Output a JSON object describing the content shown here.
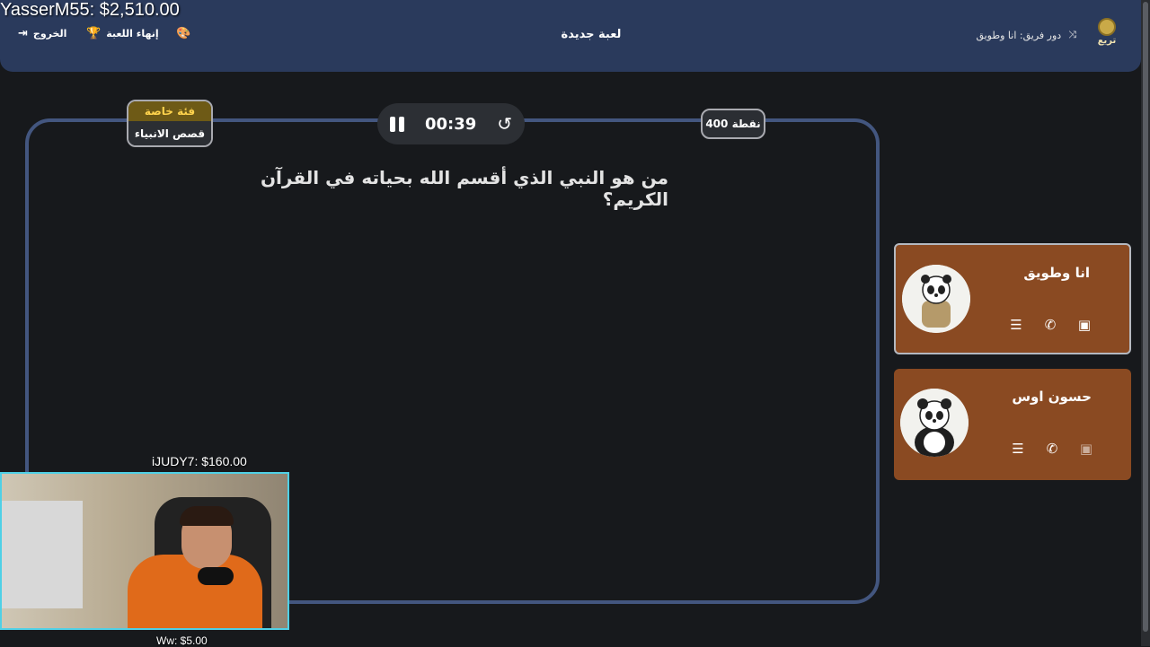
{
  "overlay": {
    "top_donation": "YasserM55: $2,510.00",
    "cam_top": "iJUDY7: $160.00",
    "cam_bottom": "Ww: $5.00"
  },
  "header": {
    "exit_label": "الخروج",
    "end_game_label": "إنهاء اللعبة",
    "title": "لعبة جديدة",
    "turn_label": "دور فريق: انا وطويق",
    "logo_text": "تريع"
  },
  "question_panel": {
    "category_header": "فئة خاصة",
    "category_name": "قصص الانبياء",
    "timer": "00:39",
    "points": "400 نقطة",
    "question": "من هو النبي الذي أقسم الله بحياته في القرآن الكريم؟"
  },
  "teams": [
    {
      "name": "انا وطويق",
      "active": true
    },
    {
      "name": "حسون اوس",
      "active": false
    }
  ],
  "colors": {
    "header_bg": "#2a3a5c",
    "board_border": "#43567f",
    "team_card": "#8a4a22",
    "category_accent": "#ffd34d",
    "cam_border": "#4fd0e6"
  }
}
